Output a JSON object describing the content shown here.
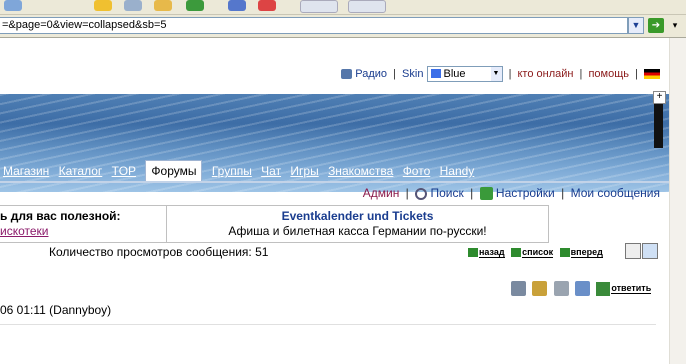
{
  "browser": {
    "address_url": "=&page=0&view=collapsed&sb=5"
  },
  "topline": {
    "radio": "Радио",
    "skin_label": "Skin",
    "skin_value": "Blue",
    "online": "кто онлайн",
    "help": "помощь"
  },
  "nav": {
    "items": [
      "Магазин",
      "Каталог",
      "TOP",
      "Форумы",
      "Группы",
      "Чат",
      "Игры",
      "Знакомства",
      "Фото",
      "Handy"
    ],
    "active_index": 3
  },
  "admin": {
    "admin": "Админ",
    "search": "Поиск",
    "settings": "Настройки",
    "my_messages": "Мои сообщения"
  },
  "ads": {
    "left_title": "ь для вас полезной:",
    "left_link": "искотеки",
    "right_title": "Eventkalender und Tickets",
    "right_sub": "Афиша и билетная касса Германии по-русски!"
  },
  "thread": {
    "views_text": "Количество просмотров сообщения: 51",
    "back": "назад",
    "list": "список",
    "forward": "вперед",
    "reply": "ответить",
    "post_date": "06 01:11 (Dannyboy)"
  }
}
